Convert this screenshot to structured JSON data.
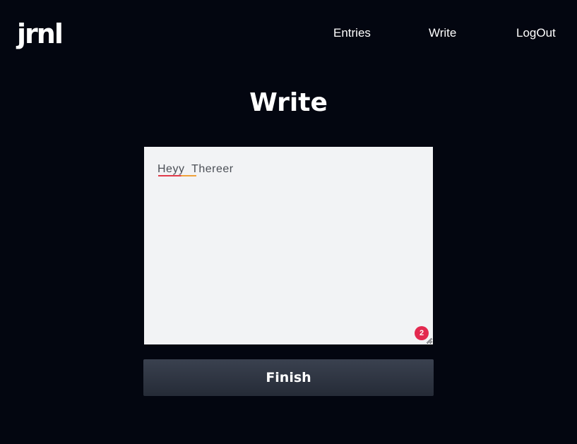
{
  "nav": {
    "logo": "jrnl",
    "links": [
      {
        "label": "Entries"
      },
      {
        "label": "Write"
      },
      {
        "label": "LogOut"
      }
    ]
  },
  "page": {
    "title": "Write"
  },
  "editor": {
    "value": "Heyy  Thereer",
    "error_count": "2"
  },
  "actions": {
    "finish_label": "Finish"
  },
  "colors": {
    "background": "#030610",
    "editor_bg": "#f2f3f5",
    "button_bg": "#2d3440",
    "badge": "#e3294f",
    "text": "#ffffff"
  }
}
